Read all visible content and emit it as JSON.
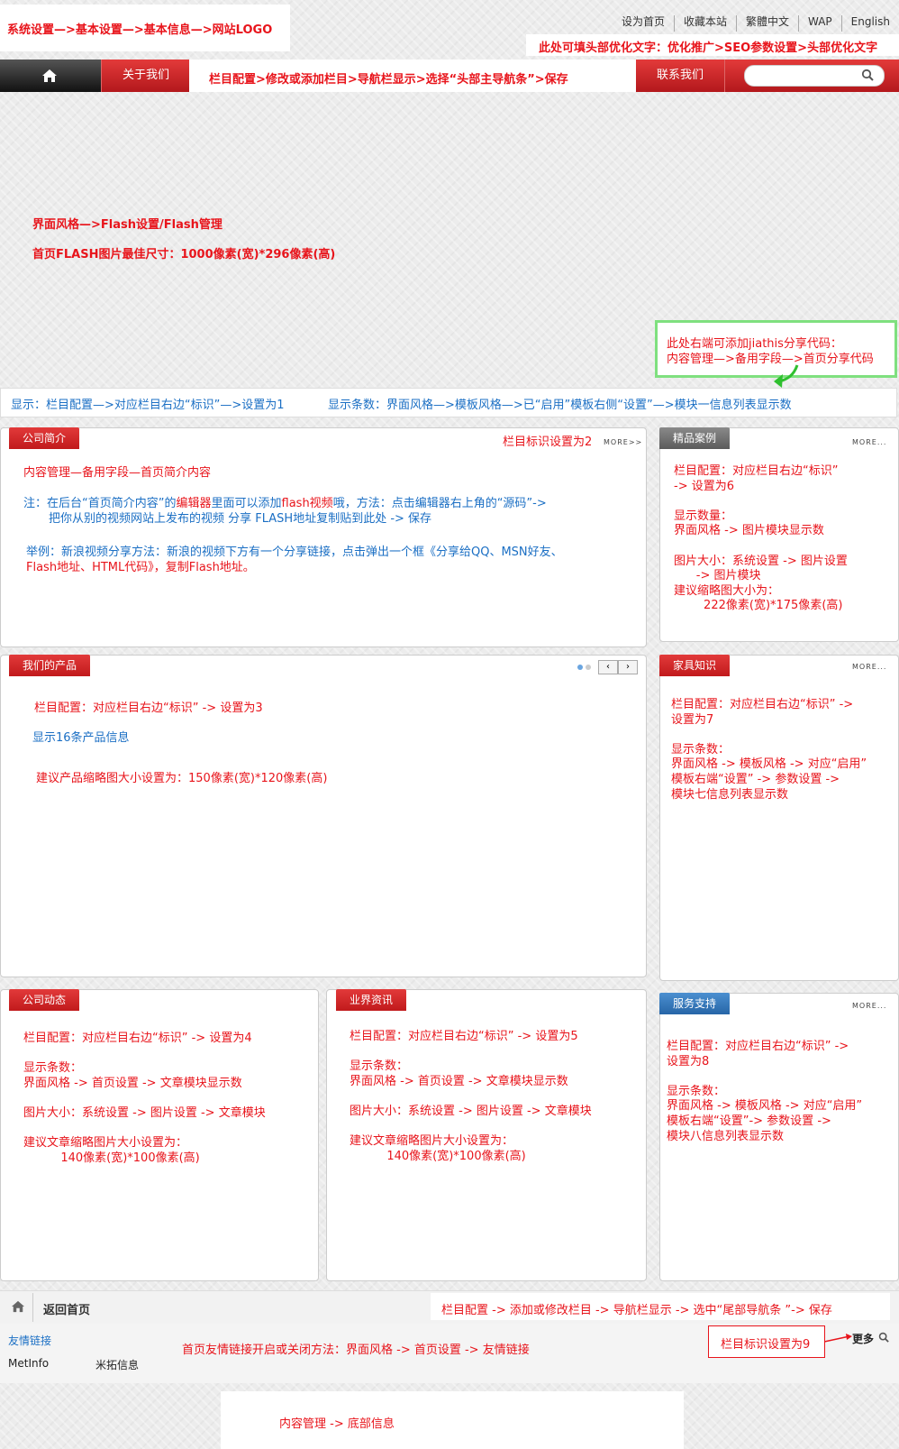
{
  "header": {
    "logo_note": "系统设置—>基本设置—>基本信息—>网站LOGO",
    "top_links": [
      "设为首页",
      "收藏本站",
      "繁體中文",
      "WAP",
      "English"
    ],
    "seo_note": "此处可填头部优化文字：优化推广>SEO参数设置>头部优化文字"
  },
  "nav": {
    "home_icon": "home-icon",
    "about": "关于我们",
    "nav_note": "栏目配置>修改或添加栏目>导航栏显示>选择“头部主导航条”>保存",
    "contact": "联系我们",
    "search_placeholder": ""
  },
  "flash": {
    "line1": "界面风格—>Flash设置/Flash管理",
    "line2": "首页FLASH图片最佳尺寸：1000像素(宽)*296像素(高)",
    "share1": "此处右端可添加jiathis分享代码：",
    "share2": "内容管理—>备用字段—>首页分享代码"
  },
  "infobar": {
    "left": "显示：栏目配置—>对应栏目右边“标识”—>设置为1",
    "right": "显示条数：界面风格—>模板风格—>已“启用”模板右侧“设置”—>模块一信息列表显示数"
  },
  "intro": {
    "tab": "公司简介",
    "flag": "栏目标识设置为2",
    "more": "MORE>>",
    "l1": "内容管理—备用字段—首页简介内容",
    "l2a": "注：在后台“首页简介内容”的",
    "l2b": "编辑器",
    "l2c": "里面可以添加",
    "l2d": "flash视频",
    "l2e": "哦，方法：点击编辑器右上角的“源码”->",
    "l3": "把你从别的视频网站上发布的视频 分享 FLASH地址复制贴到此处 -> 保存",
    "l4a": "举例：新浪视频分享方法：新浪的视频下方有一个分享链接，点击弹出一个框《分享给QQ、MSN好友、",
    "l4b": "Flash地址、HTML代码》，复制Flash地址。"
  },
  "cases": {
    "tab": "精品案例",
    "more": "MORE...",
    "lines": [
      "栏目配置：对应栏目右边“标识”",
      "-> 设置为6",
      "",
      "显示数量：",
      "界面风格 -> 图片模块显示数",
      "",
      "图片大小：系统设置 -> 图片设置",
      "      -> 图片模块",
      "建议缩略图大小为：",
      "        222像素(宽)*175像素(高)"
    ]
  },
  "products": {
    "tab": "我们的产品",
    "l1": "栏目配置：对应栏目右边“标识” -> 设置为3",
    "l2": "显示16条产品信息",
    "l3": "建议产品缩略图大小设置为：150像素(宽)*120像素(高)"
  },
  "furniture": {
    "tab": "家具知识",
    "more": "MORE...",
    "lines": [
      "栏目配置：对应栏目右边“标识” ->",
      "设置为7",
      "",
      "显示条数：",
      "界面风格 -> 模板风格 -> 对应“启用”",
      "模板右端“设置” -> 参数设置 ->",
      "模块七信息列表显示数"
    ]
  },
  "news": {
    "tab": "公司动态",
    "lines": [
      "栏目配置：对应栏目右边“标识” -> 设置为4",
      "",
      "显示条数：",
      "界面风格 -> 首页设置 -> 文章模块显示数",
      "",
      "图片大小：系统设置 -> 图片设置 -> 文章模块",
      "",
      "建议文章缩略图片大小设置为：",
      "          140像素(宽)*100像素(高)"
    ]
  },
  "industry": {
    "tab": "业界资讯",
    "lines": [
      "栏目配置：对应栏目右边“标识” -> 设置为5",
      "",
      "显示条数：",
      "界面风格 -> 首页设置 -> 文章模块显示数",
      "",
      "图片大小：系统设置 -> 图片设置 -> 文章模块",
      "",
      "建议文章缩略图片大小设置为：",
      "          140像素(宽)*100像素(高)"
    ]
  },
  "service": {
    "tab": "服务支持",
    "more": "MORE...",
    "lines": [
      "栏目配置：对应栏目右边“标识” ->",
      "设置为8",
      "",
      "显示条数：",
      "界面风格 -> 模板风格 -> 对应“启用”",
      "模板右端“设置”-> 参数设置 ->",
      "模块八信息列表显示数"
    ]
  },
  "footer": {
    "back": "返回首页",
    "nav_note": "栏目配置 -> 添加或修改栏目 -> 导航栏显示 -> 选中“尾部导航条 ”-> 保存",
    "links_title": "友情链接",
    "link1": "MetInfo",
    "link2": "米拓信息",
    "links_note": "首页友情链接开启或关闭方法：界面风格 -> 首页设置 -> 友情链接",
    "flag9": "栏目标识设置为9",
    "more": "更多",
    "bottom_note": "内容管理 -> 底部信息"
  },
  "colors": {
    "accent_red": "#e8141b",
    "link_blue": "#1b6fc4",
    "green_box": "#7fe07f"
  }
}
